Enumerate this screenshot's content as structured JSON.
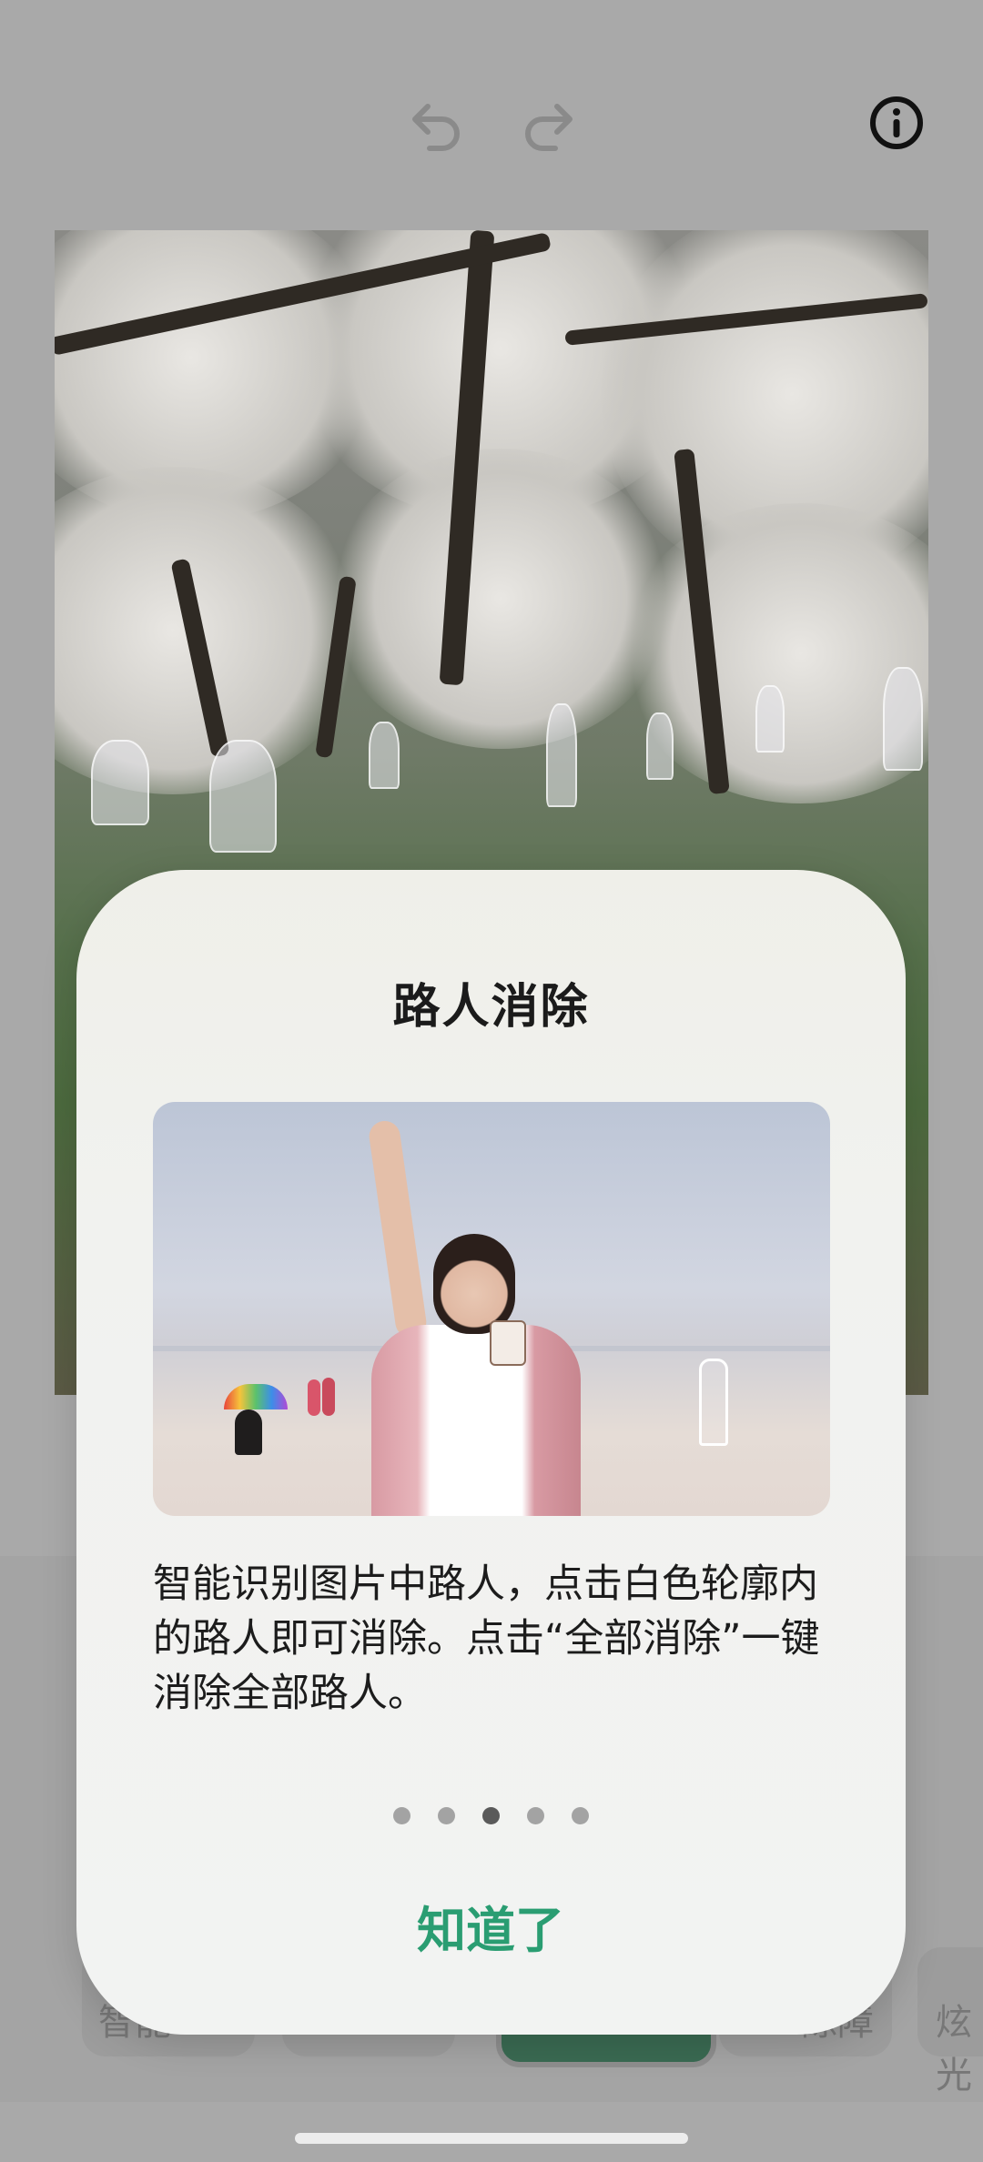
{
  "toolbar": {
    "undo_icon": "undo-arrow-icon",
    "redo_icon": "redo-arrow-icon",
    "info_icon": "info-circle-icon"
  },
  "bottom_tools": {
    "left_partial_label": "智能",
    "right_partial_label_a": "除障",
    "right_partial_label_b": "炫光"
  },
  "dialog": {
    "title": "路人消除",
    "description": "智能识别图片中路人，点击白色轮廓内的路人即可消除。点击“全部消除”一键消除全部路人。",
    "page_indicator": {
      "total": 5,
      "active_index": 2
    },
    "confirm_label": "知道了"
  },
  "colors": {
    "accent": "#2a9d72",
    "dim_background": "#a9a9a9"
  }
}
